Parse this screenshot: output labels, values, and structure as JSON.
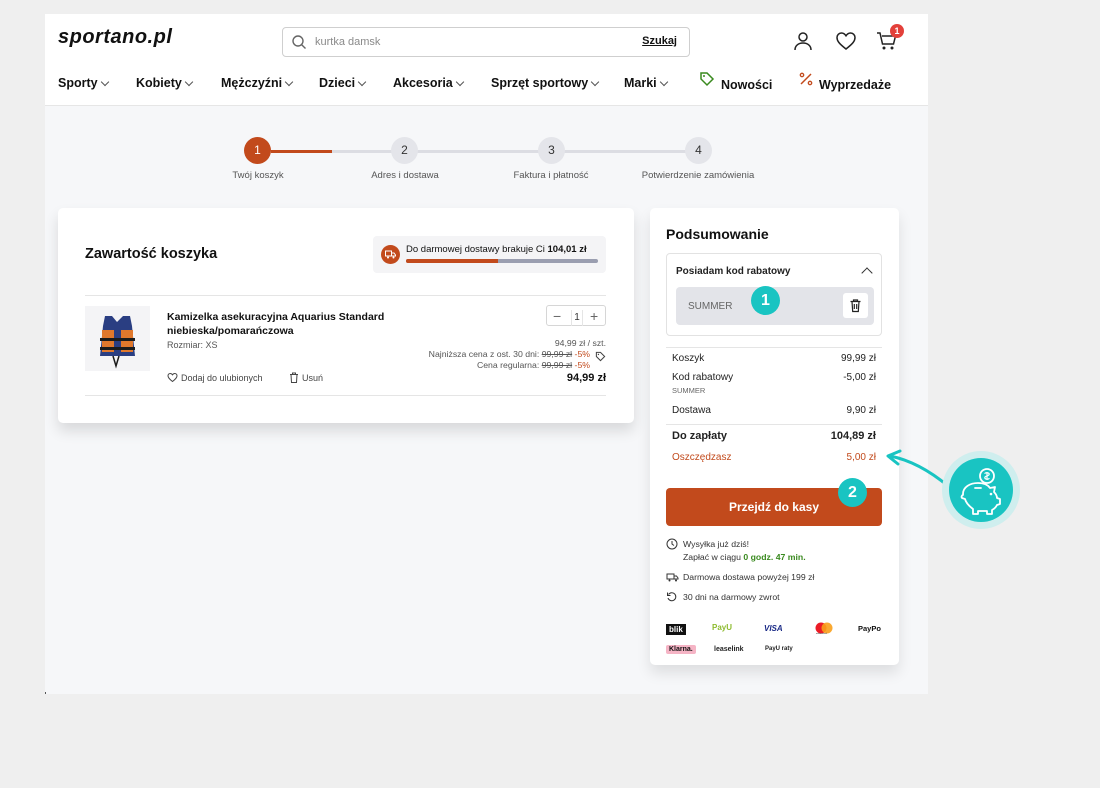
{
  "header": {
    "logo": "sportano.pl",
    "search_placeholder": "kurtka damsk",
    "search_button": "Szukaj",
    "cart_count": "1",
    "icons": [
      "search-icon",
      "user-icon",
      "heart-icon",
      "cart-icon"
    ]
  },
  "nav": {
    "items": [
      "Sporty",
      "Kobiety",
      "Mężczyźni",
      "Dzieci",
      "Akcesoria",
      "Sprzęt sportowy",
      "Marki"
    ],
    "new_label": "Nowości",
    "sale_label": "Wyprzedaże"
  },
  "steps": [
    {
      "number": "1",
      "label": "Twój koszyk"
    },
    {
      "number": "2",
      "label": "Adres i dostawa"
    },
    {
      "number": "3",
      "label": "Faktura i płatność"
    },
    {
      "number": "4",
      "label": "Potwierdzenie zamówienia"
    }
  ],
  "cart": {
    "title": "Zawartość koszyka",
    "free_shipping_text": "Do darmowej dostawy brakuje Ci",
    "free_shipping_amount": "104,01 zł",
    "free_shipping_progress": 0.48,
    "product": {
      "name": "Kamizelka asekuracyjna Aquarius Standard niebieska/pomarańczowa",
      "size": "Rozmiar: XS",
      "quantity": "1",
      "unit_price": "94,99 zł / szt.",
      "lowest_price_label": "Najniższa cena z ost. 30 dni:",
      "lowest_price_old": "99,99 zł",
      "lowest_price_pct": "-5%",
      "regular_price_label": "Cena regularna:",
      "regular_price_old": "99,99 zł",
      "regular_price_pct": "-5%",
      "total": "94,99 zł",
      "favorite_label": "Dodaj do ulubionych",
      "remove_label": "Usuń"
    }
  },
  "summary": {
    "title": "Podsumowanie",
    "promo_label": "Posiadam kod rabatowy",
    "promo_code": "SUMMER",
    "rows": {
      "subtotal_label": "Koszyk",
      "subtotal_value": "99,99 zł",
      "discount_label": "Kod rabatowy",
      "discount_code": "SUMMER",
      "discount_value": "-5,00 zł",
      "shipping_label": "Dostawa",
      "shipping_value": "9,90 zł",
      "total_label": "Do zapłaty",
      "total_value": "104,89 zł",
      "savings_label": "Oszczędzasz",
      "savings_value": "5,00 zł"
    },
    "checkout_label": "Przejdź do kasy",
    "info": {
      "ship_today": "Wysyłka już dziś!",
      "pay_within": "Zapłać w ciągu",
      "pay_time": "0 godz. 47 min.",
      "free_delivery": "Darmowa dostawa powyżej 199 zł",
      "free_return": "30 dni na darmowy zwrot"
    },
    "payments": [
      "blik",
      "PayU",
      "VISA",
      "mastercard",
      "PayPo",
      "Klarna.",
      "leaselink",
      "PayU raty"
    ]
  },
  "annotations": {
    "first": "1",
    "second": "2"
  },
  "colors": {
    "accent": "#c24a1c",
    "teal": "#19c4c2",
    "green": "#3a8a1f"
  }
}
